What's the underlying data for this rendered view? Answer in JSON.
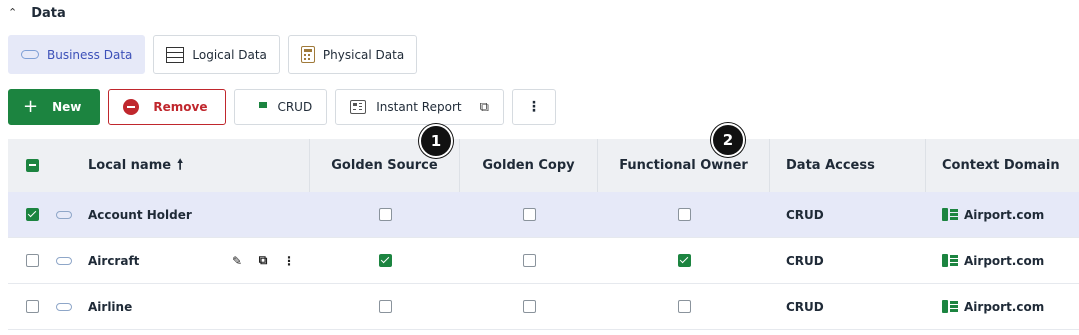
{
  "section": {
    "title": "Data"
  },
  "tabs": [
    {
      "label": "Business Data",
      "icon": "pill-icon",
      "active": true
    },
    {
      "label": "Logical Data",
      "icon": "table-grid-icon",
      "active": false
    },
    {
      "label": "Physical Data",
      "icon": "calculator-icon",
      "active": false
    }
  ],
  "toolbar": {
    "new_label": "New",
    "remove_label": "Remove",
    "crud_label": "CRUD",
    "instant_report_label": "Instant Report"
  },
  "table": {
    "columns": [
      "Local name",
      "Golden Source",
      "Golden Copy",
      "Functional Owner",
      "Data Access",
      "Context Domain"
    ],
    "rows": [
      {
        "name": "Account Holder",
        "selected": true,
        "golden_source": false,
        "golden_copy": false,
        "functional_owner": false,
        "data_access": "CRUD",
        "context_domain": "Airport.com"
      },
      {
        "name": "Aircraft",
        "selected": false,
        "golden_source": true,
        "golden_copy": false,
        "functional_owner": true,
        "data_access": "CRUD",
        "context_domain": "Airport.com"
      },
      {
        "name": "Airline",
        "selected": false,
        "golden_source": false,
        "golden_copy": false,
        "functional_owner": false,
        "data_access": "CRUD",
        "context_domain": "Airport.com"
      }
    ]
  },
  "callouts": [
    "1",
    "2"
  ],
  "colors": {
    "accent": "#1c8440",
    "danger": "#c0272d",
    "selected_row": "#e6e9f8",
    "header_bg": "#eef0f3"
  }
}
